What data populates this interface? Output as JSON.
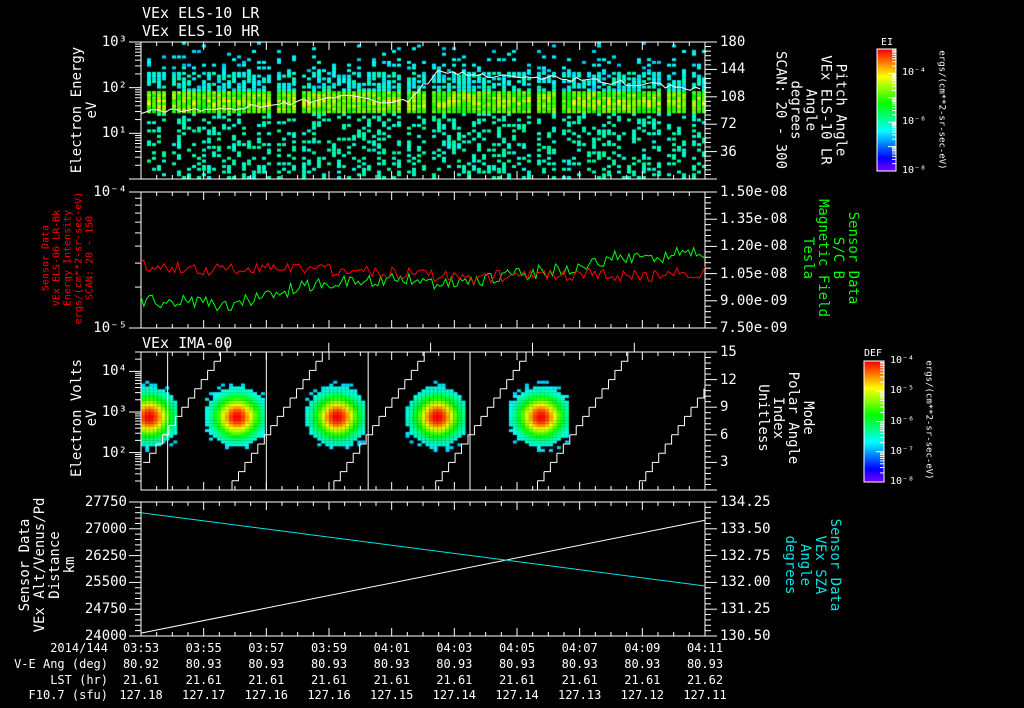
{
  "titles": {
    "panel1_line1": "VEx ELS-10 LR",
    "panel1_line2": "VEx ELS-10 HR",
    "panel3": "VEx IMA-00"
  },
  "colors": {
    "axis": "#ffffff",
    "red_series": "#ff0000",
    "green_series": "#00ff00",
    "cyan_series": "#00e5e5"
  },
  "chart_data": [
    {
      "type": "heatmap",
      "name": "ELS electron spectrogram",
      "ylabel": "Electron Energy\neV",
      "yscale": "log",
      "ylim": [
        1,
        1000
      ],
      "yticks": [
        "10¹",
        "10²",
        "10³"
      ],
      "ytick_values": [
        10,
        100,
        1000
      ],
      "y2label": "Pitch Angle\nVEx ELS-10 LR\nAngle\ndegrees\nSCAN: 20 - 300",
      "y2lim": [
        0,
        180
      ],
      "y2ticks": [
        "36",
        "72",
        "108",
        "144",
        "180"
      ],
      "band_energy_eV": [
        25,
        80
      ],
      "pitch_angle_mean_deg": [
        88,
        90,
        91,
        92,
        96,
        100,
        104,
        110,
        103,
        104,
        140,
        138,
        136,
        135,
        133,
        130,
        127,
        124,
        121,
        118
      ],
      "colorbar": {
        "title": "EI",
        "ticks": [
          "10⁻⁴",
          "10⁻⁶",
          "10⁻⁸"
        ],
        "label": "ergs/(cm**2-sr-sec-eV)",
        "range_log": [
          -8,
          -3
        ]
      }
    },
    {
      "type": "line",
      "name": "ELS background and magnetic field",
      "ylabel": "Sensor Data\nVEx ELS-06 LR-Bk\nEnergy Intensity\nergs/(cm**2-sr-sec-eV)\nSCAN: 20 - 150",
      "yscale": "log",
      "ylim": [
        1e-05,
        0.0001
      ],
      "yticks": [
        "10⁻⁵",
        "10⁻⁴"
      ],
      "y2label": "Sensor Data\nS/C B\nMagnetic Field\nTesla",
      "y2lim": [
        7.5e-09,
        1.5e-08
      ],
      "y2ticks": [
        "7.50e-09",
        "9.00e-09",
        "1.05e-08",
        "1.20e-08",
        "1.35e-08",
        "1.50e-08"
      ],
      "series": [
        {
          "name": "ELS-06 LR-Bk energy intensity",
          "axis": "left",
          "values": [
            2.9e-05,
            2.8e-05,
            2.7e-05,
            2.7e-05,
            2.8e-05,
            2.8e-05,
            2.7e-05,
            2.6e-05,
            2.6e-05,
            2.5e-05,
            2.4e-05,
            2.3e-05,
            2.4e-05,
            2.4e-05,
            2.4e-05,
            2.5e-05,
            2.4e-05,
            2.4e-05,
            2.5e-05,
            2.6e-05
          ]
        },
        {
          "name": "S/C B magnetic field",
          "axis": "right",
          "values": [
            9.1e-09,
            8.9e-09,
            9e-09,
            8.6e-09,
            9.3e-09,
            9.6e-09,
            9.9e-09,
            1e-08,
            1.02e-08,
            1.03e-08,
            9.9e-09,
            1.01e-08,
            1.03e-08,
            1.05e-08,
            1.07e-08,
            1.1e-08,
            1.14e-08,
            1.13e-08,
            1.16e-08,
            1.17e-08
          ]
        }
      ]
    },
    {
      "type": "heatmap",
      "name": "IMA ion spectrogram",
      "ylabel": "Electron Volts\neV",
      "yscale": "log",
      "ylim": [
        12,
        30000
      ],
      "yticks": [
        "10²",
        "10³",
        "10⁴"
      ],
      "ytick_values": [
        100,
        1000,
        10000
      ],
      "y2label": "Mode\nPolar Angle\nIndex\nUnitless",
      "y2lim": [
        0,
        15
      ],
      "y2ticks": [
        "3",
        "6",
        "9",
        "12",
        "15"
      ],
      "burst_times_min": [
        0.2,
        3.0,
        6.2,
        9.4,
        12.7
      ],
      "burst_energy_eV": 700,
      "mode_change_times_min": [
        0.85,
        4.0,
        7.25,
        10.5
      ],
      "polar_sweep_period_min": 3.25,
      "colorbar": {
        "title": "DEF",
        "ticks": [
          "10⁻⁴",
          "10⁻⁵",
          "10⁻⁶",
          "10⁻⁷",
          "10⁻⁸"
        ],
        "label": "ergs/(cm**2-sr-sec-eV)",
        "range_log": [
          -8,
          -4
        ]
      }
    },
    {
      "type": "line",
      "name": "Altitude and SZA",
      "ylabel": "Sensor Data\nVEx Alt/Venus/Pd\nDistance\nkm",
      "ylim": [
        24000,
        27750
      ],
      "yticks": [
        "24000",
        "24750",
        "25500",
        "26250",
        "27000",
        "27750"
      ],
      "y2label": "Sensor Data\nVEx SZA\nAngle\ndegrees",
      "y2lim": [
        130.5,
        134.25
      ],
      "y2ticks": [
        "130.50",
        "131.25",
        "132.00",
        "132.75",
        "133.50",
        "134.25"
      ],
      "series": [
        {
          "name": "Altitude km",
          "axis": "left",
          "x_min": [
            0,
            18
          ],
          "values": [
            24080,
            27240
          ]
        },
        {
          "name": "SZA deg",
          "axis": "right",
          "x_min": [
            0,
            18
          ],
          "values": [
            133.95,
            131.9
          ]
        }
      ]
    }
  ],
  "time_axis": {
    "date_label": "2014/144",
    "ticks": [
      "03:53",
      "03:55",
      "03:57",
      "03:59",
      "04:01",
      "04:03",
      "04:05",
      "04:07",
      "04:09",
      "04:11"
    ],
    "rows": [
      {
        "label": "V-E Ang (deg)",
        "values": [
          "80.92",
          "80.93",
          "80.93",
          "80.93",
          "80.93",
          "80.93",
          "80.93",
          "80.93",
          "80.93",
          "80.93"
        ]
      },
      {
        "label": "LST (hr)",
        "values": [
          "21.61",
          "21.61",
          "21.61",
          "21.61",
          "21.61",
          "21.61",
          "21.61",
          "21.61",
          "21.61",
          "21.62"
        ]
      },
      {
        "label": "F10.7 (sfu)",
        "values": [
          "127.18",
          "127.17",
          "127.16",
          "127.16",
          "127.15",
          "127.14",
          "127.14",
          "127.13",
          "127.12",
          "127.11"
        ]
      }
    ]
  }
}
